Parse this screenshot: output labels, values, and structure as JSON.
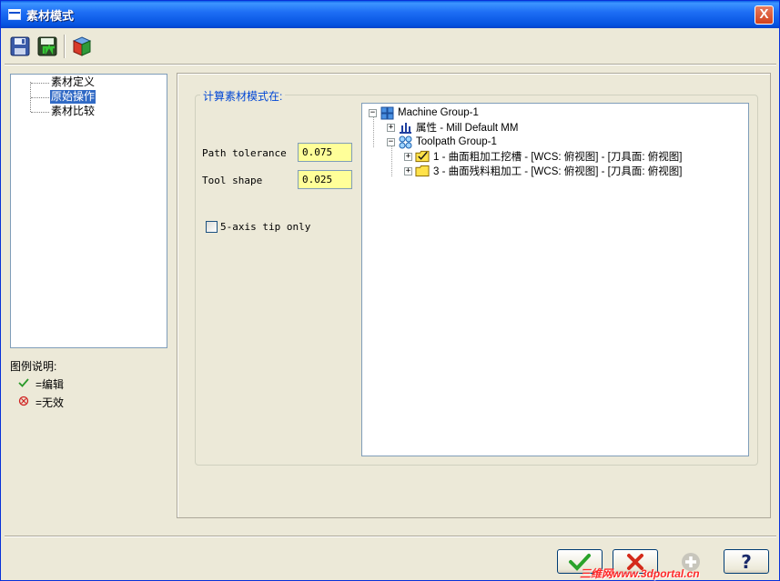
{
  "window": {
    "title": "素材模式",
    "close_label": "X"
  },
  "toolbar": {
    "buttons": [
      "save-icon",
      "save-as-icon",
      "stock-model-icon"
    ]
  },
  "nav": {
    "items": [
      {
        "label": "素材定义"
      },
      {
        "label": "原始操作",
        "selected": true
      },
      {
        "label": "素材比较"
      }
    ]
  },
  "legend": {
    "title": "图例说明:",
    "edit_label": "=编辑",
    "invalid_label": "=无效"
  },
  "settings": {
    "group_title": "计算素材模式在:",
    "path_tolerance": {
      "label": "Path tolerance",
      "value": "0.075"
    },
    "tool_shape": {
      "label": "Tool shape",
      "value": "0.025"
    },
    "five_axis": {
      "label": "5-axis tip only",
      "checked": false
    }
  },
  "ops_tree": {
    "machine_group": "Machine Group-1",
    "properties": "属性 - Mill Default MM",
    "toolpath_group": "Toolpath Group-1",
    "ops": [
      "1 - 曲面粗加工挖槽 - [WCS: 俯视图] - [刀具面: 俯视图]",
      "3 - 曲面残料粗加工 - [WCS: 俯视图] - [刀具面: 俯视图]"
    ]
  },
  "watermark": "三维网www.3dportal.cn",
  "colors": {
    "titlebar": "#0553e0",
    "input_bg": "#ffff99",
    "selected": "#316ac5",
    "legend_text": "#0046d5"
  }
}
